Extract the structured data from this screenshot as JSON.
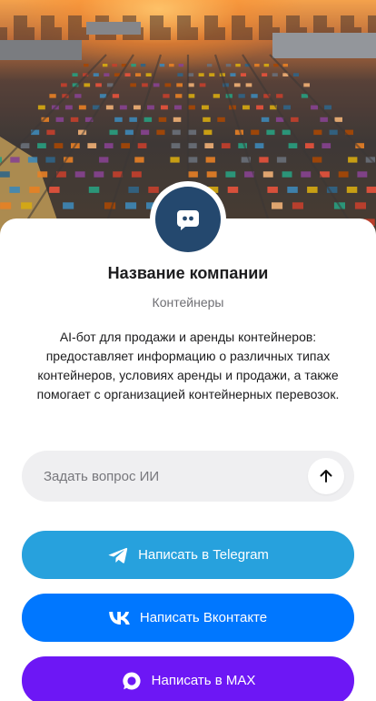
{
  "company": {
    "name": "Название компании",
    "category": "Контейнеры",
    "description": "AI-бот для продажи и аренды контейнеров: предоставляет информацию о различных типах контейнеров, условиях аренды и продажи, а также помогает с организацией контейнерных перевозок."
  },
  "ask": {
    "placeholder": "Задать вопрос ИИ",
    "value": ""
  },
  "buttons": {
    "telegram": {
      "label": "Написать в Telegram",
      "color": "#27a1dd",
      "icon": "telegram-icon"
    },
    "vk": {
      "label": "Написать Вконтакте",
      "color": "#0077ff",
      "icon": "vk-icon"
    },
    "max": {
      "label": "Написать в MAX",
      "color": "#6d17f5",
      "icon": "max-icon"
    }
  },
  "colors": {
    "avatar_bg": "#24486e",
    "ask_bg": "#efeff1"
  }
}
